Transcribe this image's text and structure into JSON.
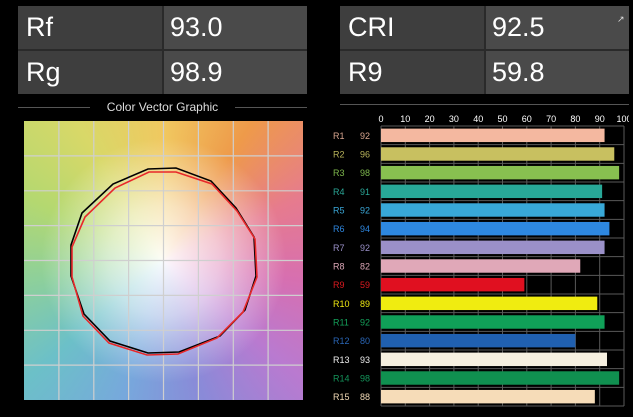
{
  "metrics": {
    "left": [
      {
        "label": "Rf",
        "value": "93.0"
      },
      {
        "label": "Rg",
        "value": "98.9"
      }
    ],
    "right": [
      {
        "label": "CRI",
        "value": "92.5"
      },
      {
        "label": "R9",
        "value": "59.8"
      }
    ],
    "corner_icon": "expand-arrow-icon"
  },
  "vector_graphic": {
    "title": "Color Vector Graphic",
    "reference_color": "#000000",
    "test_color": "#e8282a"
  },
  "chart_data": {
    "type": "bar",
    "orientation": "horizontal",
    "title": "",
    "xlabel": "",
    "ylabel": "",
    "xlim": [
      0,
      100
    ],
    "x_ticks": [
      "0",
      "10",
      "20",
      "30",
      "40",
      "50",
      "60",
      "70",
      "80",
      "90",
      "100"
    ],
    "grid": true,
    "categories": [
      "R1",
      "R2",
      "R3",
      "R4",
      "R5",
      "R6",
      "R7",
      "R8",
      "R9",
      "R10",
      "R11",
      "R12",
      "R13",
      "R14",
      "R15"
    ],
    "values": [
      92,
      96,
      98,
      91,
      92,
      94,
      92,
      82,
      59,
      89,
      92,
      80,
      93,
      98,
      88
    ],
    "bar_colors": [
      "#f4b8a0",
      "#c8c060",
      "#88c050",
      "#28a898",
      "#38a8d8",
      "#2e88e0",
      "#9a90c8",
      "#e0a8b8",
      "#e01020",
      "#f0ec10",
      "#10a058",
      "#2060b0",
      "#f6f0e0",
      "#109050",
      "#f6dcb8"
    ],
    "label_colors": [
      "#d9a68f",
      "#b8b35a",
      "#7eb84d",
      "#2aa696",
      "#3aa6d6",
      "#2e86de",
      "#9a90c8",
      "#dca6b6",
      "#dd1a20",
      "#eee812",
      "#14a05a",
      "#2a66b6",
      "#eeeeee",
      "#14945a",
      "#f2dab6"
    ]
  }
}
